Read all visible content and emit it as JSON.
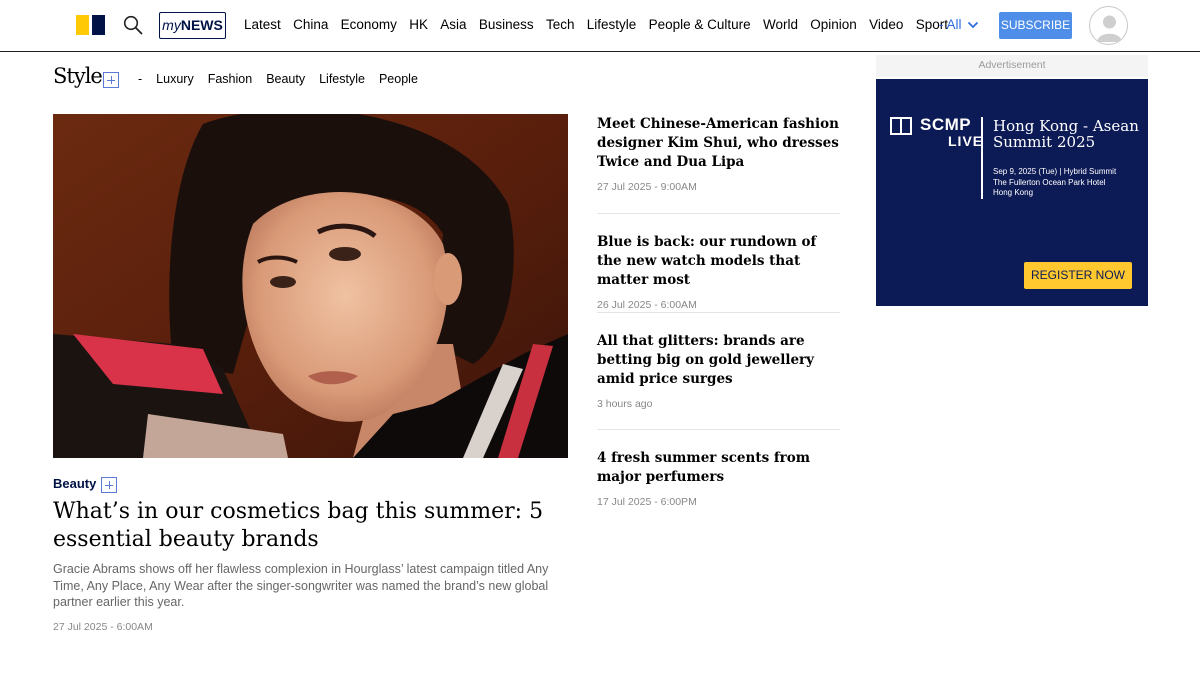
{
  "header": {
    "mynews_prefix": "my",
    "mynews_suffix": "NEWS",
    "nav": [
      "Latest",
      "China",
      "Economy",
      "HK",
      "Asia",
      "Business",
      "Tech",
      "Lifestyle",
      "People & Culture",
      "World",
      "Opinion",
      "Video",
      "Sport"
    ],
    "all_label": "- All",
    "subscribe_label": "SUBSCRIBE",
    "icons": {
      "logo": "scmp-logo-icon",
      "search": "search-icon",
      "all": "chevron-down-icon",
      "avatar": "user-avatar-icon"
    },
    "colors": {
      "logo_yellow": "#ffca05",
      "logo_navy": "#001246",
      "accent_blue": "#4e8ee8"
    }
  },
  "section_nav": {
    "logo_text": "Style",
    "separator": "-",
    "items": [
      "Luxury",
      "Fashion",
      "Beauty",
      "Lifestyle",
      "People"
    ],
    "follow_icon": "plus-box-icon"
  },
  "hero": {
    "category": "Beauty",
    "title": "What’s in our cosmetics bag this summer: 5 essential beauty brands",
    "summary": "Gracie Abrams shows off her flawless complexion in Hourglass’ latest campaign titled Any Time, Any Place, Any Wear after the singer-songwriter was named the brand’s new global partner earlier this year.",
    "date": "27 Jul 2025 - 6:00AM"
  },
  "side_stories": [
    {
      "title": "Meet Chinese-American fashion designer Kim Shui, who dresses Twice and Dua Lipa",
      "date": "27 Jul 2025 - 9:00AM"
    },
    {
      "title": "Blue is back: our rundown of the new watch models that matter most",
      "date": "26 Jul 2025 - 6:00AM"
    },
    {
      "title": "All that glitters: brands are betting big on gold jewellery amid price surges",
      "date": "3 hours ago"
    },
    {
      "title": "4 fresh summer scents from major perfumers",
      "date": "17 Jul 2025 - 6:00PM"
    }
  ],
  "ad": {
    "label": "Advertisement",
    "brand_top": "SCMP",
    "brand_bottom": "LIVE",
    "headline": "Hong Kong - Asean Summit 2025",
    "details_1": "Sep 9, 2025 (Tue) | Hybrid Summit",
    "details_2": "The Fullerton Ocean Park Hotel",
    "details_3": "Hong Kong",
    "cta": "REGISTER NOW",
    "colors": {
      "background": "#0c1a55",
      "cta": "#ffc82e"
    }
  }
}
